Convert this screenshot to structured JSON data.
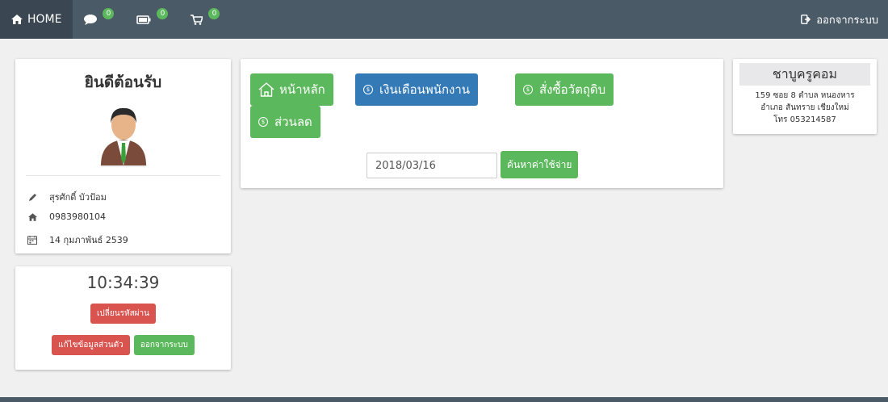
{
  "navbar": {
    "home_label": "HOME",
    "messages_count": "0",
    "wallet_count": "0",
    "cart_count": "0",
    "logout_label": "ออกจากระบบ"
  },
  "profile": {
    "welcome": "ยินดีต้อนรับ",
    "name": "สุรศักดิ์ บัวป้อม",
    "phone": "0983980104",
    "birthdate": "14 กุมภาพันธ์ 2539"
  },
  "clock": {
    "time": "10:34:39",
    "change_password": "เปลี่ยนรหัสผ่าน",
    "edit_profile": "แก้ไขข้อมูลส่วนตัว",
    "logout": "ออกจากระบบ"
  },
  "main": {
    "home_btn": "หน้าหลัก",
    "salary_btn": "เงินเดือนพนักงาน",
    "purchase_btn": "สั่งซื้อวัตถุดิบ",
    "discount_btn": "ส่วนลด",
    "date_value": "2018/03/16",
    "search_btn": "ค้นหาค่าใช้จ่าย"
  },
  "company": {
    "name": "ชาบูครูคอม",
    "address_line1": "159 ซอย 8 ตำบล หนองหาร",
    "address_line2": "อำเภอ สันทราย เชียงใหม่",
    "phone_line": "โทร 053214587"
  },
  "colors": {
    "navbar": "#4a5a67",
    "success": "#5cb85c",
    "primary": "#337ab7",
    "danger": "#d9534f"
  }
}
